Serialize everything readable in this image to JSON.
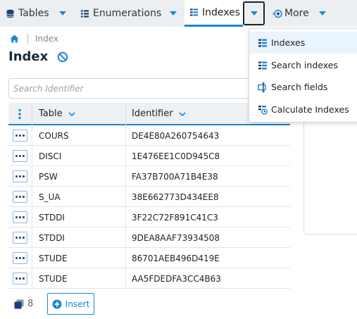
{
  "topbar": {
    "tabs": [
      {
        "label": "Tables",
        "icon": "database-icon"
      },
      {
        "label": "Enumerations",
        "icon": "list-icon"
      },
      {
        "label": "Indexes",
        "icon": "index-list-icon"
      },
      {
        "label": "More",
        "icon": "plus-circle-icon"
      }
    ],
    "active_tab": "Indexes"
  },
  "breadcrumb": {
    "home_icon": "home-icon",
    "current": "Index"
  },
  "page": {
    "title": "Index",
    "status_icon": "no-entry-icon"
  },
  "search": {
    "placeholder": "Search Identifier"
  },
  "table": {
    "headers": {
      "table": "Table",
      "identifier": "Identifier"
    },
    "rows": [
      {
        "table": "COURS",
        "identifier": "DE4E80A260754643"
      },
      {
        "table": "DISCI",
        "identifier": "1E476EE1C0D945C8"
      },
      {
        "table": "PSW",
        "identifier": "FA37B700A71B4E38"
      },
      {
        "table": "S_UA",
        "identifier": "38E662773D434EE8"
      },
      {
        "table": "STDDI",
        "identifier": "3F22C72F891C41C3"
      },
      {
        "table": "STDDI",
        "identifier": "9DEA8AAF73934508"
      },
      {
        "table": "STUDE",
        "identifier": "86701AEB496D419E"
      },
      {
        "table": "STUDE",
        "identifier": "AA5FDEDFA3CC4B63"
      }
    ]
  },
  "footer": {
    "count": "8",
    "insert_label": "Insert"
  },
  "menu": {
    "items": [
      {
        "label": "Indexes",
        "icon": "index-list-icon",
        "selected": true
      },
      {
        "label": "Search indexes",
        "icon": "search-list-icon",
        "selected": false
      },
      {
        "label": "Search fields",
        "icon": "search-field-icon",
        "selected": false
      },
      {
        "label": "Calculate Indexes",
        "icon": "calculate-icon",
        "selected": false
      }
    ]
  },
  "colors": {
    "accent": "#1a86d8",
    "tabbar": "#eceff2",
    "dark_icon": "#1a3d78"
  }
}
